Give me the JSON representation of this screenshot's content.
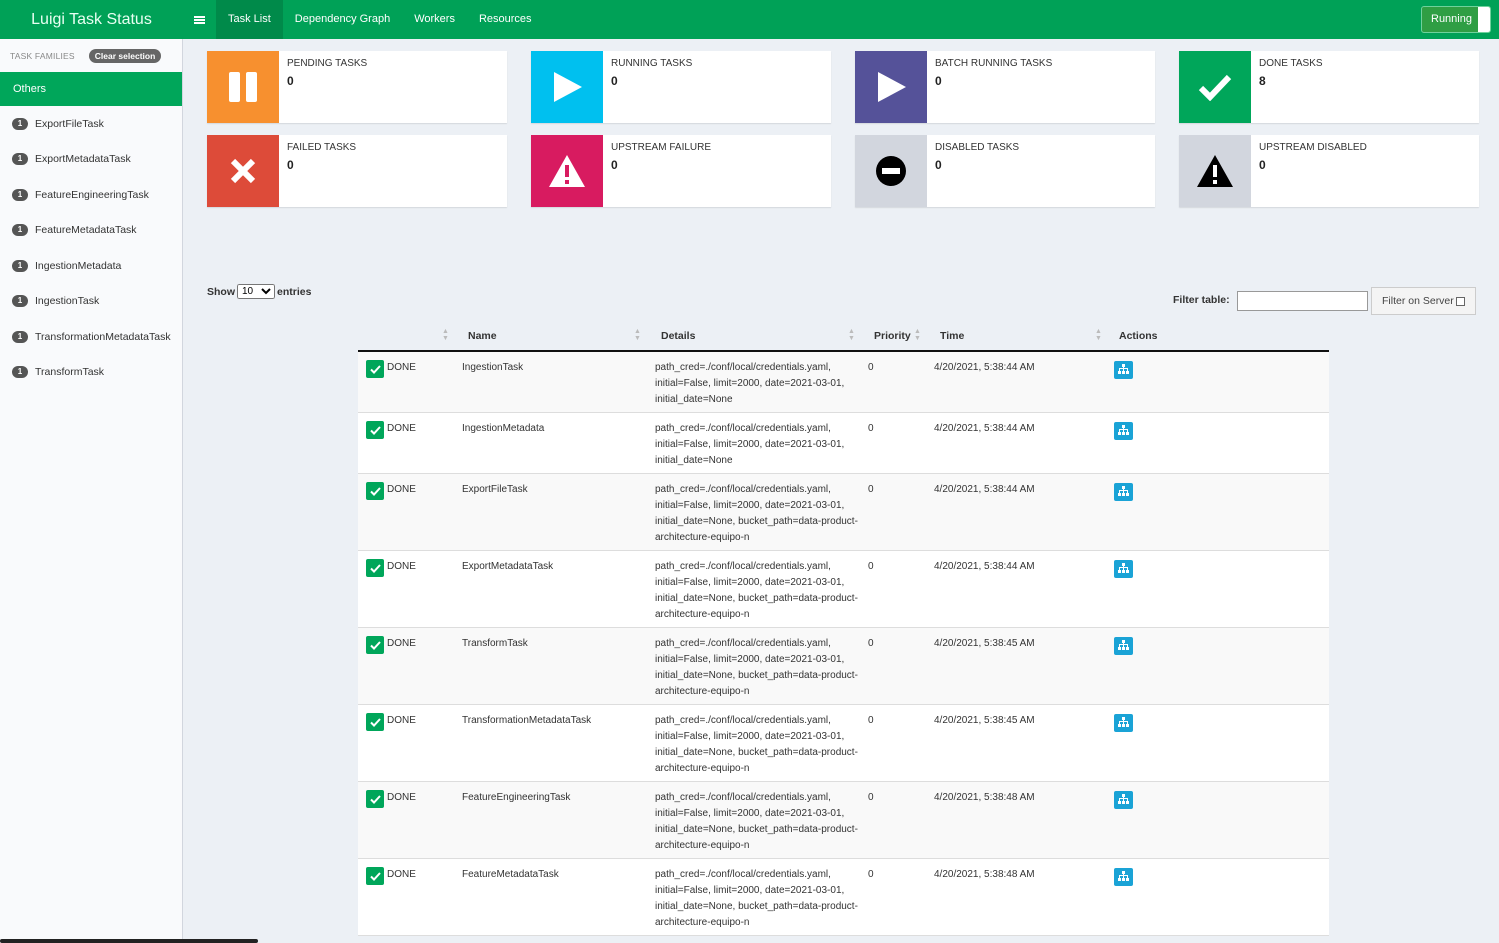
{
  "app": {
    "title": "Luigi Task Status"
  },
  "nav": {
    "tabs": [
      {
        "label": "Task List"
      },
      {
        "label": "Dependency Graph"
      },
      {
        "label": "Workers"
      },
      {
        "label": "Resources"
      }
    ],
    "status_button": "Running"
  },
  "sidebar": {
    "header": "TASK FAMILIES",
    "clear_label": "Clear selection",
    "group": "Others",
    "items": [
      {
        "count": "1",
        "name": "ExportFileTask"
      },
      {
        "count": "1",
        "name": "ExportMetadataTask"
      },
      {
        "count": "1",
        "name": "FeatureEngineeringTask"
      },
      {
        "count": "1",
        "name": "FeatureMetadataTask"
      },
      {
        "count": "1",
        "name": "IngestionMetadata"
      },
      {
        "count": "1",
        "name": "IngestionTask"
      },
      {
        "count": "1",
        "name": "TransformationMetadataTask"
      },
      {
        "count": "1",
        "name": "TransformTask"
      }
    ]
  },
  "summary": [
    {
      "label": "PENDING TASKS",
      "count": "0",
      "color": "#f7902f",
      "icon": "pause-icon"
    },
    {
      "label": "RUNNING TASKS",
      "count": "0",
      "color": "#00c0ef",
      "icon": "play-icon"
    },
    {
      "label": "BATCH RUNNING TASKS",
      "count": "0",
      "color": "#555299",
      "icon": "play-icon"
    },
    {
      "label": "DONE TASKS",
      "count": "8",
      "color": "#00a65a",
      "icon": "check-icon"
    },
    {
      "label": "FAILED TASKS",
      "count": "0",
      "color": "#dd4b39",
      "icon": "x-icon"
    },
    {
      "label": "UPSTREAM FAILURE",
      "count": "0",
      "color": "#d81b60",
      "icon": "warning-icon"
    },
    {
      "label": "DISABLED TASKS",
      "count": "0",
      "color": "#d2d6de",
      "icon": "minus-circle-icon"
    },
    {
      "label": "UPSTREAM DISABLED",
      "count": "0",
      "color": "#d2d6de",
      "icon": "warning-icon"
    }
  ],
  "table_controls": {
    "show_label": "Show",
    "page_size": "10",
    "entries_label": "entries",
    "filter_label": "Filter table:",
    "filter_value": "",
    "filter_server_label": "Filter on Server"
  },
  "table": {
    "headers": {
      "name": "Name",
      "details": "Details",
      "priority": "Priority",
      "time": "Time",
      "actions": "Actions"
    },
    "rows": [
      {
        "status": "DONE",
        "name": "IngestionTask",
        "details": "path_cred=./conf/local/credentials.yaml, initial=False, limit=2000, date=2021-03-01, initial_date=None",
        "priority": "0",
        "time": "4/20/2021, 5:38:44 AM"
      },
      {
        "status": "DONE",
        "name": "IngestionMetadata",
        "details": "path_cred=./conf/local/credentials.yaml, initial=False, limit=2000, date=2021-03-01, initial_date=None",
        "priority": "0",
        "time": "4/20/2021, 5:38:44 AM"
      },
      {
        "status": "DONE",
        "name": "ExportFileTask",
        "details": "path_cred=./conf/local/credentials.yaml, initial=False, limit=2000, date=2021-03-01, initial_date=None, bucket_path=data-product-architecture-equipo-n",
        "priority": "0",
        "time": "4/20/2021, 5:38:44 AM"
      },
      {
        "status": "DONE",
        "name": "ExportMetadataTask",
        "details": "path_cred=./conf/local/credentials.yaml, initial=False, limit=2000, date=2021-03-01, initial_date=None, bucket_path=data-product-architecture-equipo-n",
        "priority": "0",
        "time": "4/20/2021, 5:38:44 AM"
      },
      {
        "status": "DONE",
        "name": "TransformTask",
        "details": "path_cred=./conf/local/credentials.yaml, initial=False, limit=2000, date=2021-03-01, initial_date=None, bucket_path=data-product-architecture-equipo-n",
        "priority": "0",
        "time": "4/20/2021, 5:38:45 AM"
      },
      {
        "status": "DONE",
        "name": "TransformationMetadataTask",
        "details": "path_cred=./conf/local/credentials.yaml, initial=False, limit=2000, date=2021-03-01, initial_date=None, bucket_path=data-product-architecture-equipo-n",
        "priority": "0",
        "time": "4/20/2021, 5:38:45 AM"
      },
      {
        "status": "DONE",
        "name": "FeatureEngineeringTask",
        "details": "path_cred=./conf/local/credentials.yaml, initial=False, limit=2000, date=2021-03-01, initial_date=None, bucket_path=data-product-architecture-equipo-n",
        "priority": "0",
        "time": "4/20/2021, 5:38:48 AM"
      },
      {
        "status": "DONE",
        "name": "FeatureMetadataTask",
        "details": "path_cred=./conf/local/credentials.yaml, initial=False, limit=2000, date=2021-03-01, initial_date=None, bucket_path=data-product-architecture-equipo-n",
        "priority": "0",
        "time": "4/20/2021, 5:38:48 AM"
      }
    ]
  }
}
